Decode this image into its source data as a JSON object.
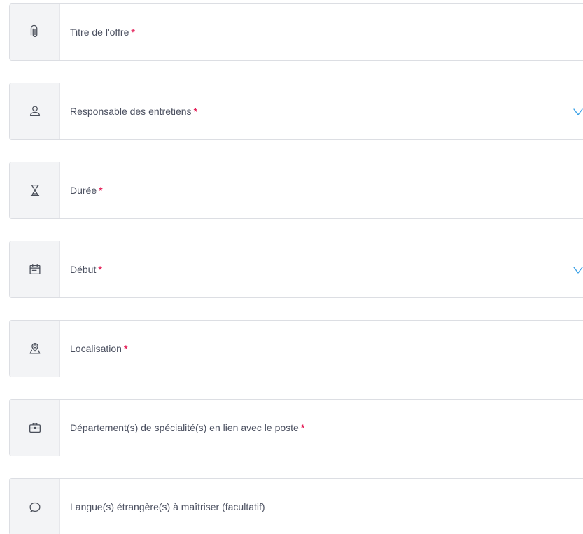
{
  "form": {
    "fields": [
      {
        "label": "Titre de l'offre",
        "required_mark": "*",
        "icon": "paperclip-icon",
        "has_dropdown": false
      },
      {
        "label": "Responsable des entretiens",
        "required_mark": "*",
        "icon": "user-icon",
        "has_dropdown": true
      },
      {
        "label": "Durée",
        "required_mark": "*",
        "icon": "hourglass-icon",
        "has_dropdown": false
      },
      {
        "label": "Début",
        "required_mark": "*",
        "icon": "calendar-icon",
        "has_dropdown": true
      },
      {
        "label": "Localisation",
        "required_mark": "*",
        "icon": "map-pin-icon",
        "has_dropdown": false
      },
      {
        "label": "Département(s) de spécialité(s) en lien avec le poste",
        "required_mark": "*",
        "icon": "briefcase-icon",
        "has_dropdown": false
      },
      {
        "label": "Langue(s) étrangère(s) à maîtriser (facultatif)",
        "required_mark": "",
        "icon": "speech-bubble-icon",
        "has_dropdown": false
      }
    ]
  },
  "colors": {
    "required_mark": "#e5245c",
    "chevron": "#3aa0e6",
    "icon_box_bg": "#f3f4f6",
    "border": "#dcdee3",
    "label": "#4b5060"
  }
}
